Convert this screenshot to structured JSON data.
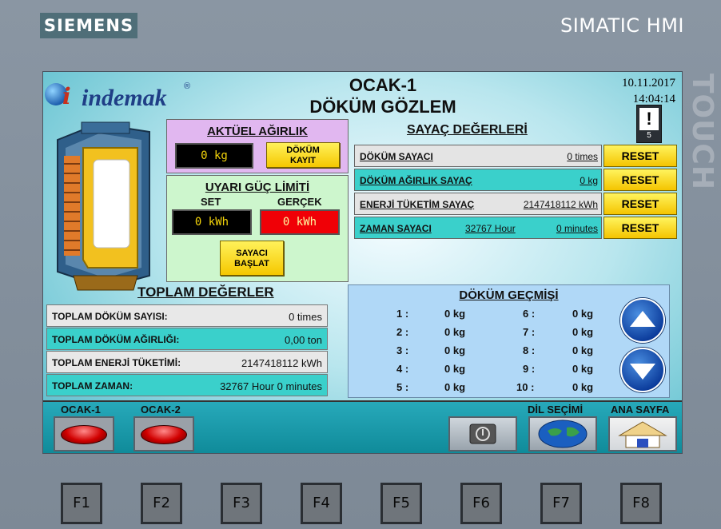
{
  "bezel": {
    "brand": "SIEMENS",
    "model": "SIMATIC HMI",
    "touch_label": "TOUCH",
    "fkeys": [
      "F1",
      "F2",
      "F3",
      "F4",
      "F5",
      "F6",
      "F7",
      "F8"
    ]
  },
  "header": {
    "logo_text": "indemak",
    "logo_i": "i",
    "logo_reg": "®",
    "title_line1": "OCAK-1",
    "title_line2": "DÖKÜM GÖZLEM",
    "date": "10.11.2017",
    "time": "14:04:14",
    "alarm_symbol": "!",
    "alarm_count": "5"
  },
  "aktuel": {
    "title": "AKTÜEL AĞIRLIK",
    "value": "0 kg",
    "button_line1": "DÖKÜM",
    "button_line2": "KAYIT"
  },
  "uyari": {
    "title": "UYARI GÜÇ LİMİTİ",
    "set_label": "SET",
    "gercek_label": "GERÇEK",
    "set_value": "0 kWh",
    "gercek_value": "0 kWh",
    "button_line1": "SAYACI",
    "button_line2": "BAŞLAT"
  },
  "sayac": {
    "title": "SAYAÇ DEĞERLERİ",
    "reset_label": "RESET",
    "rows": [
      {
        "label": "DÖKÜM SAYACI",
        "value": "0 times",
        "value2": ""
      },
      {
        "label": "DÖKÜM AĞIRLIK SAYAÇ",
        "value": "0  kg",
        "value2": ""
      },
      {
        "label": "ENERJİ TÜKETİM SAYAÇ",
        "value": "2147418112  kWh",
        "value2": ""
      },
      {
        "label": "ZAMAN SAYACI",
        "value": "32767  Hour",
        "value2": "0  minutes"
      }
    ]
  },
  "toplam": {
    "title": "TOPLAM DEĞERLER",
    "rows": [
      {
        "label": "TOPLAM DÖKÜM SAYISI:",
        "value": "0 times"
      },
      {
        "label": "TOPLAM DÖKÜM AĞIRLIĞI:",
        "value": "0,00  ton"
      },
      {
        "label": "TOPLAM ENERJİ TÜKETİMİ:",
        "value": "2147418112  kWh"
      },
      {
        "label": "TOPLAM ZAMAN:",
        "value": "32767  Hour   0  minutes"
      }
    ]
  },
  "gecmis": {
    "title": "DÖKÜM GEÇMİŞİ",
    "left": [
      {
        "idx": "1 :",
        "val": "0  kg"
      },
      {
        "idx": "2 :",
        "val": "0  kg"
      },
      {
        "idx": "3 :",
        "val": "0  kg"
      },
      {
        "idx": "4 :",
        "val": "0  kg"
      },
      {
        "idx": "5 :",
        "val": "0  kg"
      }
    ],
    "right": [
      {
        "idx": "6 :",
        "val": "0  kg"
      },
      {
        "idx": "7 :",
        "val": "0  kg"
      },
      {
        "idx": "8 :",
        "val": "0  kg"
      },
      {
        "idx": "9 :",
        "val": "0  kg"
      },
      {
        "idx": "10 :",
        "val": "0  kg"
      }
    ]
  },
  "bottom": {
    "ocak1": "OCAK-1",
    "ocak2": "OCAK-2",
    "dil": "DİL SEÇİMİ",
    "ana": "ANA SAYFA"
  },
  "colors": {
    "reset_yellow": "#f5c800",
    "row_cyan": "#3ad0cb",
    "aktuel_panel": "#e1b7f0",
    "uyari_panel": "#cdf6cd",
    "history_panel": "#b0d8f7"
  }
}
